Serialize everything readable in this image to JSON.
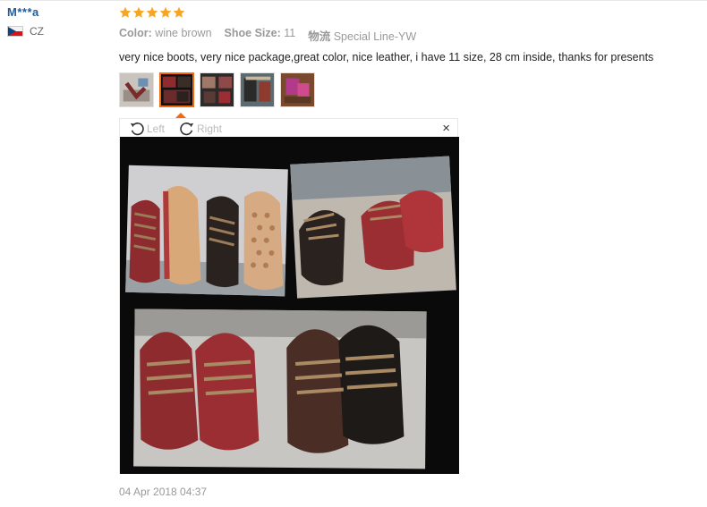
{
  "review": {
    "username": "M***a",
    "country": "CZ",
    "rating": 5,
    "attributes": [
      {
        "name": "Color:",
        "value": "wine brown"
      },
      {
        "name": "Shoe Size:",
        "value": "11"
      },
      {
        "name": "物流",
        "value": "Special Line-YW"
      }
    ],
    "text": "very nice boots, very nice package,great color, nice leather, i have 11 size, 28 cm inside, thanks for presents",
    "date": "04 Apr 2018 04:37"
  },
  "viewer": {
    "rotate_left_label": "Left",
    "rotate_right_label": "Right",
    "close_label": "×"
  },
  "colors": {
    "username": "#1c5da0",
    "star": "#f6a623",
    "accent": "#f06a0e",
    "wine": "#8e2b2f",
    "dark_leather": "#2a221e",
    "sole": "#d8a878"
  }
}
